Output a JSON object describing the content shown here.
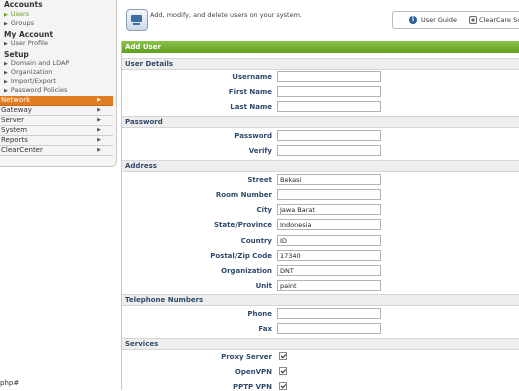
{
  "sidebar": {
    "accounts": {
      "title": "Accounts",
      "items": [
        "Users",
        "Groups"
      ],
      "active": "Users"
    },
    "my_account": {
      "title": "My Account",
      "items": [
        "User Profile"
      ]
    },
    "setup": {
      "title": "Setup",
      "items": [
        "Domain and LDAP",
        "Organization",
        "Import/Export",
        "Password Policies"
      ]
    },
    "categories": [
      "Network",
      "Gateway",
      "Server",
      "System",
      "Reports",
      "ClearCenter"
    ],
    "active_category": "Network",
    "accent_color": "#e07b24"
  },
  "status_text": "php#",
  "header": {
    "description": "Add, modify, and delete users on your system.",
    "user_guide": "User Guide",
    "clearcare": "ClearCare Supp",
    "icons": [
      "user-admin-icon",
      "info-icon",
      "clearcare-icon"
    ]
  },
  "form": {
    "title": "Add User",
    "title_color": "#6aab2a",
    "sections": {
      "user_details": {
        "title": "User Details",
        "fields": [
          {
            "label": "Username",
            "value": ""
          },
          {
            "label": "First Name",
            "value": ""
          },
          {
            "label": "Last Name",
            "value": ""
          }
        ]
      },
      "password": {
        "title": "Password",
        "fields": [
          {
            "label": "Password",
            "value": ""
          },
          {
            "label": "Verify",
            "value": ""
          }
        ]
      },
      "address": {
        "title": "Address",
        "fields": [
          {
            "label": "Street",
            "value": "Bekasi"
          },
          {
            "label": "Room Number",
            "value": ""
          },
          {
            "label": "City",
            "value": "Jawa Barat"
          },
          {
            "label": "State/Province",
            "value": "Indonesia"
          },
          {
            "label": "Country",
            "value": "ID"
          },
          {
            "label": "Postal/Zip Code",
            "value": "17340"
          },
          {
            "label": "Organization",
            "value": "DNT"
          },
          {
            "label": "Unit",
            "value": "paint"
          }
        ]
      },
      "telephone": {
        "title": "Telephone Numbers",
        "fields": [
          {
            "label": "Phone",
            "value": ""
          },
          {
            "label": "Fax",
            "value": ""
          }
        ]
      },
      "services": {
        "title": "Services",
        "items": [
          {
            "label": "Proxy Server",
            "checked": true
          },
          {
            "label": "OpenVPN",
            "checked": true
          },
          {
            "label": "PPTP VPN",
            "checked": true
          }
        ]
      }
    }
  }
}
